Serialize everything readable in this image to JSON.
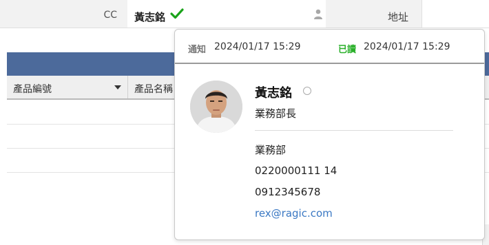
{
  "form": {
    "cc_label": "CC",
    "cc_value": "黃志銘",
    "address_label": "地址"
  },
  "subtable": {
    "columns": [
      "產品編號",
      "產品名稱"
    ]
  },
  "popover": {
    "notify_label": "通知",
    "notify_time": "2024/01/17 15:29",
    "read_label": "已讀",
    "read_time": "2024/01/17 15:29",
    "name": "黃志銘",
    "job_title": "業務部長",
    "department": "業務部",
    "phone": "0220000111 14",
    "mobile": "0912345678",
    "email": "rex@ragic.com"
  },
  "colors": {
    "section_bar": "#4c6a9b",
    "read_green": "#2ab02a",
    "check_green": "#1aa31a",
    "link_blue": "#3a78c3"
  },
  "icons": [
    "check-icon",
    "user-icon",
    "sort-down-icon",
    "status-icon",
    "avatar"
  ]
}
